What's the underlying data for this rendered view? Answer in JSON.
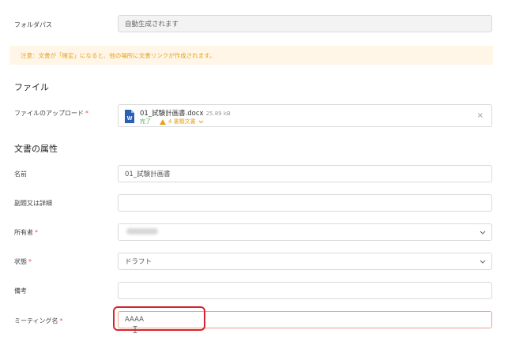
{
  "folder_path": {
    "label": "フォルダパス",
    "value": "自動生成されます"
  },
  "notice": "注意：文書が「確定」になると、他の場所に文書リンクが作成されます。",
  "file_section": {
    "title": "ファイル"
  },
  "upload": {
    "label": "ファイルのアップロード",
    "file_name": "01_試験計画書.docx",
    "file_size": "25.89 kB",
    "status": "完了",
    "warning": "4 書類文書",
    "icon": "word-file-icon"
  },
  "attributes_section": {
    "title": "文書の属性"
  },
  "fields": {
    "name": {
      "label": "名前",
      "value": "01_試験計画書"
    },
    "subtitle": {
      "label": "副題又は詳細",
      "value": ""
    },
    "owner": {
      "label": "所有者",
      "value": ""
    },
    "status": {
      "label": "状態",
      "value": "ドラフト"
    },
    "remarks": {
      "label": "備考",
      "value": ""
    },
    "meeting_name": {
      "label": "ミーティング名",
      "value": "AAAA"
    }
  },
  "required_mark": "*",
  "colors": {
    "accent_orange": "#e6a11f",
    "notice_bg": "#fff6e8",
    "required_red": "#e8534a",
    "highlight_red": "#d7242c",
    "success_green": "#52b55a",
    "active_border": "#f0a08a"
  }
}
